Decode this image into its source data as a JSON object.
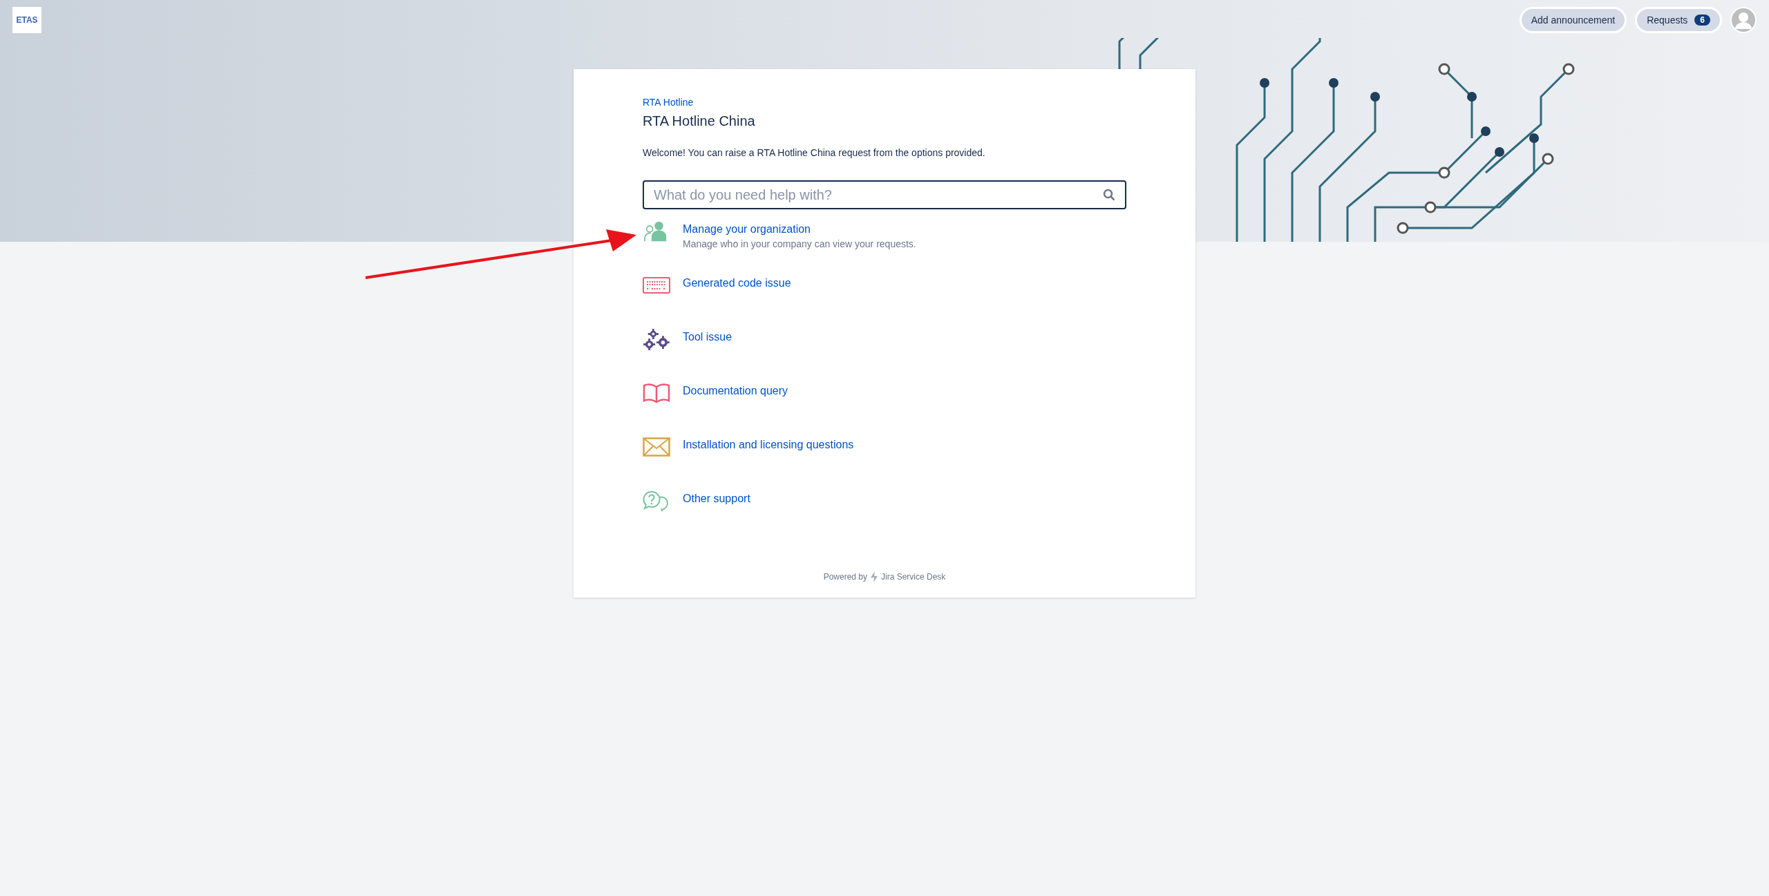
{
  "logo": {
    "text": "ETAS"
  },
  "header": {
    "buttons": [
      {
        "label": "Add announcement"
      },
      {
        "label": "Requests",
        "count": "6"
      }
    ]
  },
  "portal": {
    "breadcrumb": "RTA Hotline",
    "title": "RTA Hotline China",
    "welcome": "Welcome! You can raise a RTA Hotline China request from the options provided.",
    "search": {
      "placeholder": "What do you need help with?"
    },
    "options": [
      {
        "kind": "people",
        "label": "Manage your organization",
        "description": "Manage who in your company can view your requests."
      },
      {
        "kind": "keyboard",
        "label": "Generated code issue"
      },
      {
        "kind": "gears",
        "label": "Tool issue"
      },
      {
        "kind": "book",
        "label": "Documentation query"
      },
      {
        "kind": "envelope",
        "label": "Installation and licensing questions"
      },
      {
        "kind": "chat",
        "label": "Other support"
      }
    ]
  },
  "footer": {
    "prefix": "Powered by",
    "product": "Jira Service Desk"
  }
}
